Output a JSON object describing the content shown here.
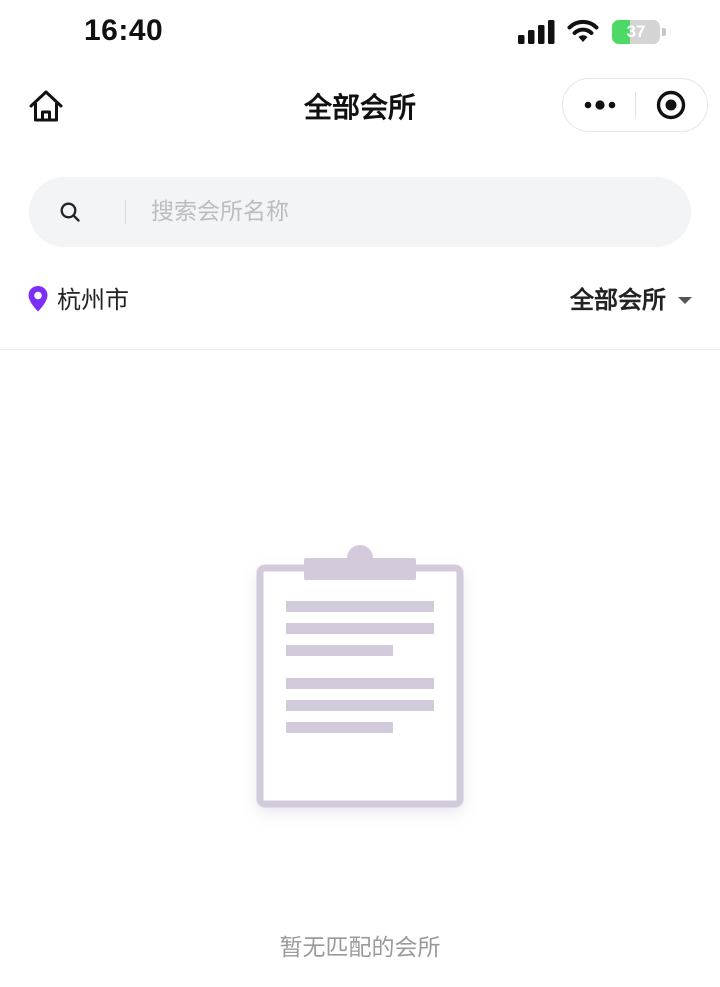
{
  "status_bar": {
    "time": "16:40",
    "battery_percent": "37",
    "battery_level": 0.37,
    "icons": [
      "signal-icon",
      "wifi-icon",
      "battery-charging-icon"
    ]
  },
  "nav": {
    "title": "全部会所",
    "icons": [
      "home-icon",
      "more-dots-icon",
      "close-target-icon"
    ]
  },
  "search": {
    "placeholder": "搜索会所名称",
    "value": ""
  },
  "filter": {
    "city": "杭州市",
    "category": "全部会所",
    "icons": [
      "location-pin-icon",
      "caret-down-icon"
    ]
  },
  "empty_state": {
    "message": "暂无匹配的会所",
    "icon": "clipboard-icon"
  },
  "colors": {
    "accent": "#7b2ff7",
    "illustration": "#d3cadb",
    "search_bg": "#f3f4f5",
    "muted_text": "#9a9a9a",
    "battery_green": "#4cd964"
  }
}
